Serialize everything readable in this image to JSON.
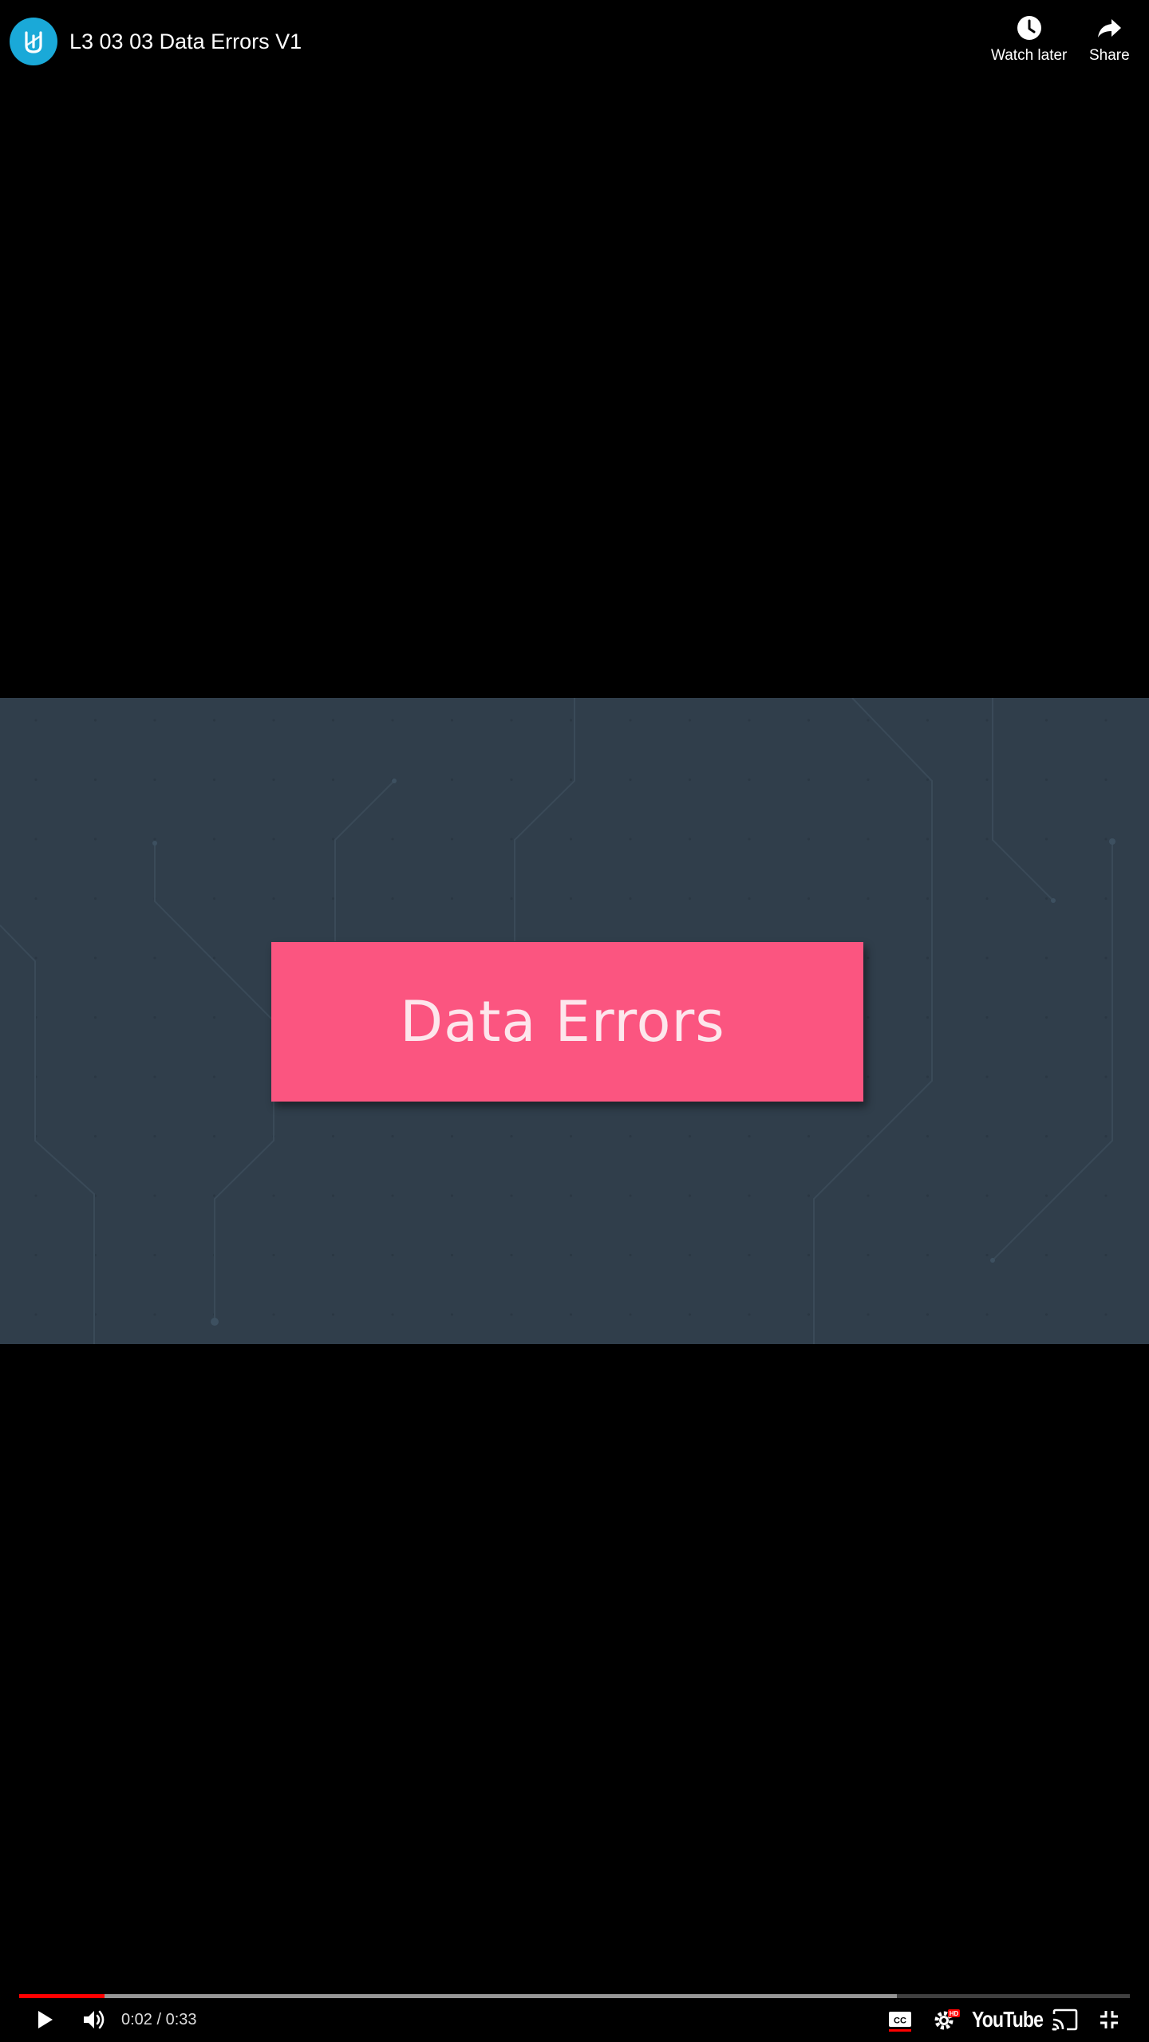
{
  "header": {
    "title": "L3 03 03 Data Errors V1",
    "channel_avatar_icon": "udacity-logo-icon",
    "watch_later_label": "Watch later",
    "share_label": "Share"
  },
  "video": {
    "slide_title": "Data Errors",
    "slide_bg_color": "#303e4b",
    "card_color": "#fb5580"
  },
  "controls": {
    "time": "0:02 / 0:33",
    "played_fraction": 0.077,
    "buffered_fraction": 0.79,
    "play_icon": "play-icon",
    "volume_icon": "volume-icon",
    "cc_icon": "closed-captions-icon",
    "settings_icon": "settings-hd-icon",
    "brand": "YouTube",
    "cast_icon": "cast-icon",
    "fullscreen_icon": "exit-fullscreen-icon"
  }
}
